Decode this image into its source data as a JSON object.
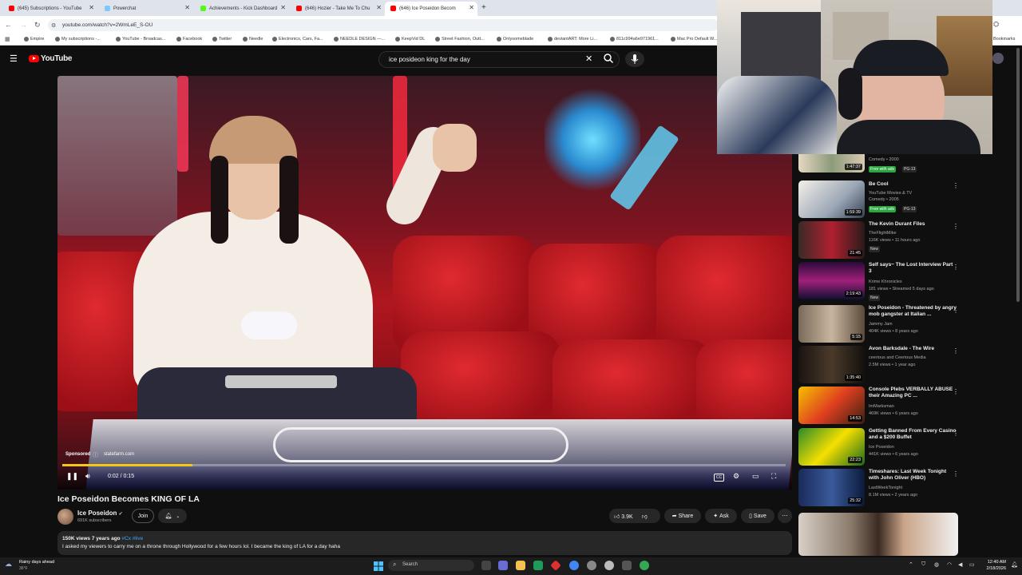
{
  "browser": {
    "tabs": [
      {
        "label": "(645) Subscriptions - YouTube",
        "active": false
      },
      {
        "label": "Powerchat",
        "active": false
      },
      {
        "label": "Achievements - Kick Dashboard",
        "active": false
      },
      {
        "label": "(646) Hozier - Take Me To Chu",
        "active": false
      },
      {
        "label": "(646) Ice Poseidon Becom",
        "active": true
      }
    ],
    "new_tab": "+",
    "url": "youtube.com/watch?v=2WmLeE_S-OU",
    "bookmarks": [
      "Empire",
      "My subscriptions -...",
      "YouTube - Broadcas...",
      "Facebook",
      "Twitter",
      "Needle",
      "Electronics, Cars, Fa...",
      "NEEDLE DESIGN —...",
      "KeepVid DL",
      "Street Fashion, Outt...",
      "Onlysomeblade",
      "deviantART: More Li...",
      "811c994a6e971961...",
      "Mac Pro Default W..."
    ],
    "bookmarks_right": "Bookmarks"
  },
  "youtube": {
    "logo_text": "YouTube",
    "search_value": "ice posideon king for the day",
    "player": {
      "sponsored_label": "Sponsored",
      "sponsor_site": "statefarm.com",
      "time": "0:02 / 0:15",
      "progress": 0.18
    },
    "video": {
      "title": "Ice Poseidon Becomes KING OF LA",
      "channel": "Ice Poseidon",
      "subscribers": "691K subscribers",
      "join_label": "Join",
      "likes": "3.9K",
      "share_label": "Share",
      "ask_label": "Ask",
      "save_label": "Save",
      "views_date": "150K views  7 years ago",
      "hashtags": "#Cx #live",
      "description": "I asked my viewers to carry me on a throne through Hollywood for a few hours lol. I became the king of LA for a day haha"
    },
    "recommendations": [
      {
        "title": "",
        "line1": "Comedy • 2000",
        "line2": "",
        "duration": "1:47:37",
        "badges": [
          "Free with ads",
          "PG-13"
        ]
      },
      {
        "title": "Be Cool",
        "line1": "YouTube Movies & TV",
        "line2": "Comedy • 2005",
        "duration": "1:59:39",
        "badges": [
          "Free with ads",
          "PG-13"
        ]
      },
      {
        "title": "The Kevin Durant Files",
        "line1": "TheFlightMike",
        "line2": "116K views • 11 hours ago",
        "duration": "21:45",
        "badges": [
          "New"
        ]
      },
      {
        "title": "Self says~ The Lost Interview Part 3",
        "line1": "Krime Khronicles",
        "line2": "181 views • Streamed 5 days ago",
        "duration": "2:19:43",
        "badges": [
          "New"
        ]
      },
      {
        "title": "Ice Poseidon - Threatened by angry mob gangster at Italian ...",
        "line1": "Jammy Jam",
        "line2": "404K views • 8 years ago",
        "duration": "5:15",
        "badges": []
      },
      {
        "title": "Avon Barksdale - The Wire",
        "line1": "ceerious and Ceerious Media",
        "line2": "2.5M views • 1 year ago",
        "duration": "1:35:40",
        "badges": []
      },
      {
        "title": "Console Plebs VERBALLY ABUSE their Amazing PC ...",
        "line1": "ImMarksman",
        "line2": "469K views • 6 years ago",
        "duration": "14:53",
        "badges": []
      },
      {
        "title": "Getting Banned From Every Casino and a $200 Buffet",
        "line1": "Ice Poseidon",
        "line2": "441K views • 6 years ago",
        "duration": "22:23",
        "badges": []
      },
      {
        "title": "Timeshares: Last Week Tonight with John Oliver (HBO)",
        "line1": "LastWeekTonight",
        "line2": "8.1M views • 2 years ago",
        "duration": "25:32",
        "badges": []
      }
    ]
  },
  "taskbar": {
    "weather_line1": "Rainy days ahead",
    "weather_line2": "36°F",
    "search_placeholder": "Search",
    "time": "12:40 AM",
    "date": "2/18/2026"
  },
  "colors": {
    "youtube_red": "#ff0000",
    "progress_yellow": "#f5c518",
    "bg": "#0f0f0f"
  }
}
